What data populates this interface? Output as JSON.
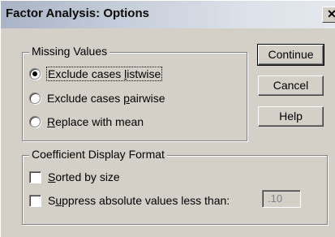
{
  "window": {
    "title": "Factor Analysis: Options",
    "close_glyph": "✕"
  },
  "missing_values": {
    "legend": "Missing Values",
    "options": [
      {
        "label_pre": "Exclude cases ",
        "mnemonic": "l",
        "label_post": "istwise",
        "selected": true
      },
      {
        "label_pre": "Exclude cases ",
        "mnemonic": "p",
        "label_post": "airwise",
        "selected": false
      },
      {
        "label_pre": "",
        "mnemonic": "R",
        "label_post": "eplace with mean",
        "selected": false
      }
    ]
  },
  "coefficient_format": {
    "legend": "Coefficient Display Format",
    "sorted": {
      "label_pre": "",
      "mnemonic": "S",
      "label_post": "orted by size",
      "checked": false
    },
    "suppress": {
      "label_pre": "S",
      "mnemonic": "u",
      "label_post": "ppress absolute values less than:",
      "checked": false
    },
    "threshold_value": ".10"
  },
  "buttons": {
    "continue": "Continue",
    "cancel": "Cancel",
    "help": "Help"
  }
}
